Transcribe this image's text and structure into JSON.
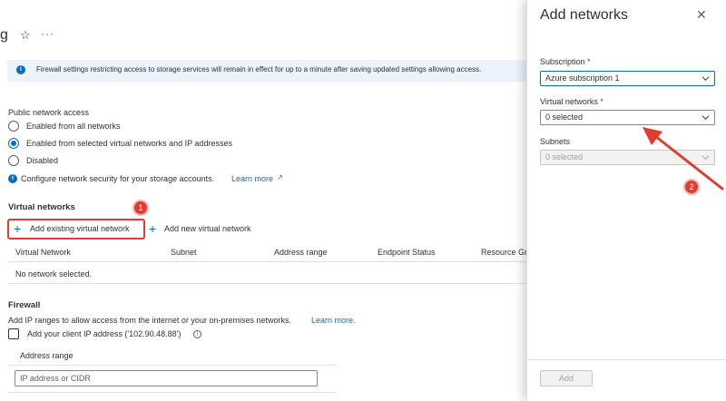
{
  "page": {
    "title_fragment": "g",
    "favorite_glyph": "☆",
    "more_glyph": "···"
  },
  "info_banner": {
    "icon": "info-icon",
    "text": "Firewall settings restricting access to storage services will remain in effect for up to a minute after saving updated settings allowing access."
  },
  "public_access": {
    "label": "Public network access",
    "options": [
      {
        "label": "Enabled from all networks",
        "selected": false
      },
      {
        "label": "Enabled from selected virtual networks and IP addresses",
        "selected": true
      },
      {
        "label": "Disabled",
        "selected": false
      }
    ],
    "hint_text": "Configure network security for your storage accounts.",
    "hint_link": "Learn more"
  },
  "virtual_networks": {
    "heading": "Virtual networks",
    "add_existing": "Add existing virtual network",
    "add_new": "Add new virtual network",
    "badge": "1",
    "columns": [
      "Virtual Network",
      "Subnet",
      "Address range",
      "Endpoint Status",
      "Resource Gr"
    ],
    "empty_text": "No network selected."
  },
  "firewall": {
    "heading": "Firewall",
    "desc": "Add IP ranges to allow access from the internet or your on-premises networks.",
    "desc_link": "Learn more.",
    "client_ip_label": "Add your client IP address ('102.90.48.88')",
    "client_ip_checked": false,
    "address_range_header": "Address range",
    "address_placeholder": "IP address or CIDR"
  },
  "panel": {
    "title": "Add networks",
    "subscription_label": "Subscription",
    "subscription_value": "Azure subscription 1",
    "vnet_label": "Virtual networks",
    "vnet_value": "0 selected",
    "subnets_label": "Subnets",
    "subnets_value": "0 selected",
    "add_button": "Add",
    "badge": "2",
    "required_mark": "*"
  },
  "colors": {
    "accent": "#0f6cbd",
    "annotation_red": "#e03c31"
  }
}
